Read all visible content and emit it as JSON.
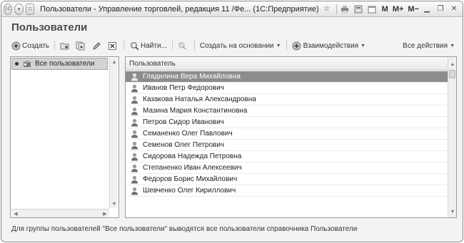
{
  "window": {
    "title": "Пользователи - Управление торговлей, редакция 11 /Фе... (1С:Предприятие)",
    "title_right": [
      "M",
      "M+",
      "M−"
    ]
  },
  "heading": "Пользователи",
  "toolbar": {
    "create_label": "Создать",
    "find_label": "Найти...",
    "create_based_label": "Создать на основании",
    "interactions_label": "Взаимодействия",
    "all_actions_label": "Все действия"
  },
  "tree": {
    "items": [
      {
        "label": "Все пользователи"
      }
    ]
  },
  "table": {
    "column_header": "Пользователь",
    "rows": [
      "Гладилина Вера Михайловна",
      "Иванов Петр Федорович",
      "Казакова Наталья Александровна",
      "Мазина Мария Константиновна",
      "Петров Сидор Иванович",
      "Семаненко Олег Павлович",
      "Семенов Олег Петрович",
      "Сидорова Надежда Петровна",
      "Степаненко Иван Алексеевич",
      "Федоров Борис Михайлович",
      "Шевченко Олег Кириллович"
    ],
    "selected_index": 0
  },
  "footer": "Для группы пользователей \"Все пользователи\" выводятся все пользователи справочника Пользователи"
}
